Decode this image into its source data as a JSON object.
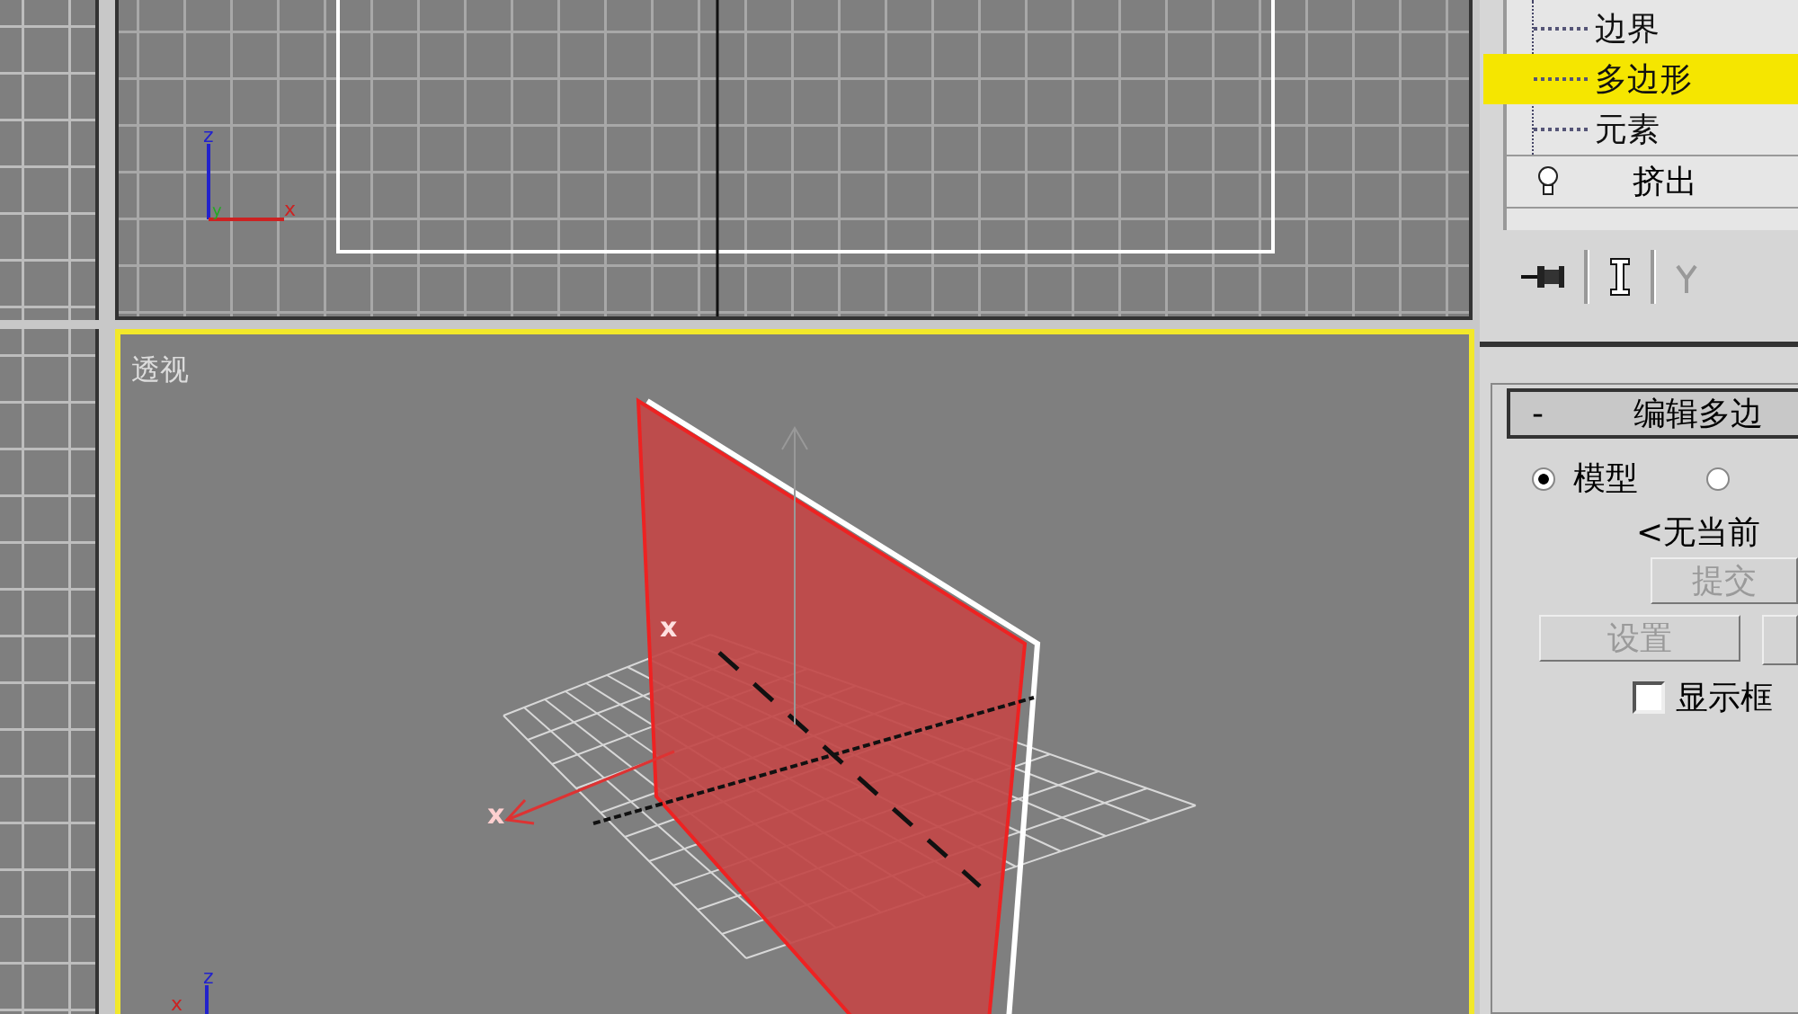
{
  "viewports": {
    "top": {
      "axes": {
        "z": "z",
        "y": "y",
        "x": "x"
      }
    },
    "perspective": {
      "label": "透视",
      "gizmo_labels": [
        "x",
        "x"
      ],
      "axes": {
        "z": "z",
        "x": "x"
      }
    }
  },
  "modifier_stack": {
    "items": [
      {
        "label": "边界",
        "selected": false
      },
      {
        "label": "多边形",
        "selected": true
      },
      {
        "label": "元素",
        "selected": false
      }
    ],
    "modifier": {
      "label": "挤出",
      "on": true
    }
  },
  "rollout": {
    "title": "编辑多边",
    "collapse": "-",
    "radios": [
      {
        "label": "模型",
        "selected": true
      },
      {
        "selected": false
      }
    ],
    "status": "<无当前",
    "commit_button": {
      "label": "提交",
      "disabled": true
    },
    "settings_button": {
      "label": "设置",
      "disabled": true
    },
    "checkbox": {
      "label": "显示框",
      "checked": false
    }
  }
}
